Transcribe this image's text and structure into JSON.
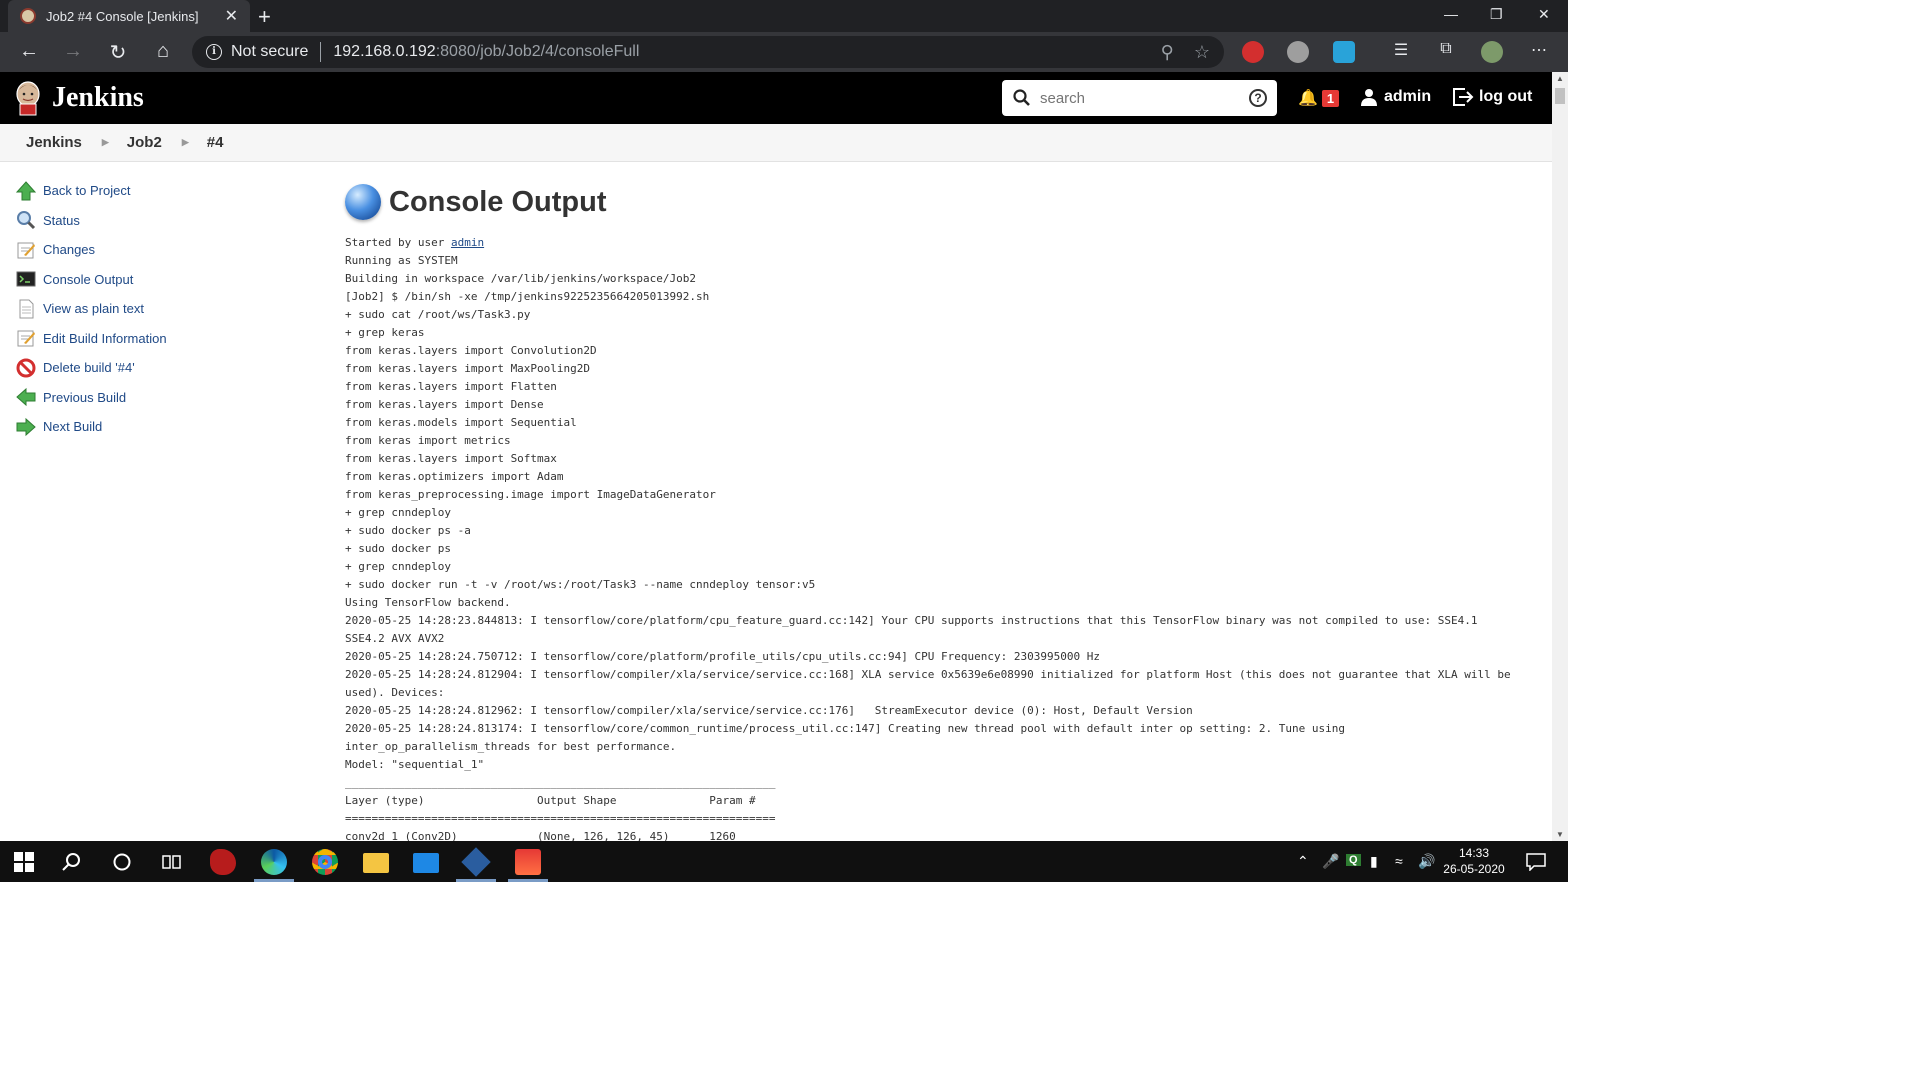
{
  "browser": {
    "tab_title": "Job2 #4 Console [Jenkins]",
    "security_label": "Not secure",
    "url_host": "192.168.0.192",
    "url_rest": ":8080/job/Job2/4/consoleFull"
  },
  "header": {
    "app_name": "Jenkins",
    "search_placeholder": "search",
    "notification_count": "1",
    "user": "admin",
    "logout": "log out"
  },
  "breadcrumb": [
    "Jenkins",
    "Job2",
    "#4"
  ],
  "sidebar": {
    "items": [
      {
        "label": "Back to Project",
        "icon": "up-arrow-icon"
      },
      {
        "label": "Status",
        "icon": "magnifier-icon"
      },
      {
        "label": "Changes",
        "icon": "notepad-icon"
      },
      {
        "label": "Console Output",
        "icon": "terminal-icon"
      },
      {
        "label": "View as plain text",
        "icon": "document-icon"
      },
      {
        "label": "Edit Build Information",
        "icon": "notepad-icon"
      },
      {
        "label": "Delete build '#4'",
        "icon": "no-entry-icon"
      },
      {
        "label": "Previous Build",
        "icon": "left-arrow-icon"
      },
      {
        "label": "Next Build",
        "icon": "right-arrow-icon"
      }
    ]
  },
  "main": {
    "title": "Console Output",
    "started_prefix": "Started by user ",
    "started_user": "admin",
    "console_lines": [
      "Running as SYSTEM",
      "Building in workspace /var/lib/jenkins/workspace/Job2",
      "[Job2] $ /bin/sh -xe /tmp/jenkins9225235664205013992.sh",
      "+ sudo cat /root/ws/Task3.py",
      "+ grep keras",
      "from keras.layers import Convolution2D",
      "from keras.layers import MaxPooling2D",
      "from keras.layers import Flatten",
      "from keras.layers import Dense",
      "from keras.models import Sequential",
      "from keras import metrics",
      "from keras.layers import Softmax",
      "from keras.optimizers import Adam",
      "from keras_preprocessing.image import ImageDataGenerator",
      "+ grep cnndeploy",
      "+ sudo docker ps -a",
      "+ sudo docker ps",
      "+ grep cnndeploy",
      "+ sudo docker run -t -v /root/ws:/root/Task3 --name cnndeploy tensor:v5",
      "Using TensorFlow backend.",
      "2020-05-25 14:28:23.844813: I tensorflow/core/platform/cpu_feature_guard.cc:142] Your CPU supports instructions that this TensorFlow binary was not compiled to use: SSE4.1",
      "SSE4.2 AVX AVX2",
      "2020-05-25 14:28:24.750712: I tensorflow/core/platform/profile_utils/cpu_utils.cc:94] CPU Frequency: 2303995000 Hz",
      "2020-05-25 14:28:24.812904: I tensorflow/compiler/xla/service/service.cc:168] XLA service 0x5639e6e08990 initialized for platform Host (this does not guarantee that XLA will be",
      "used). Devices:",
      "2020-05-25 14:28:24.812962: I tensorflow/compiler/xla/service/service.cc:176]   StreamExecutor device (0): Host, Default Version",
      "2020-05-25 14:28:24.813174: I tensorflow/core/common_runtime/process_util.cc:147] Creating new thread pool with default inter op setting: 2. Tune using",
      "inter_op_parallelism_threads for best performance.",
      "Model: \"sequential_1\"",
      "_________________________________________________________________",
      "Layer (type)                 Output Shape              Param #   ",
      "=================================================================",
      "conv2d_1 (Conv2D)            (None, 126, 126, 45)      1260      "
    ]
  },
  "taskbar": {
    "time": "14:33",
    "date": "26-05-2020"
  }
}
